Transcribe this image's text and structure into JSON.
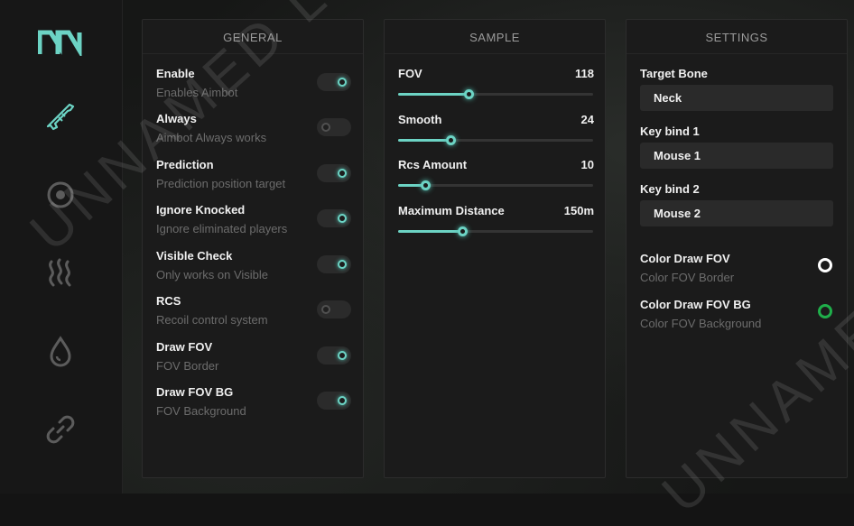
{
  "theme": {
    "accent": "#6cd3c4",
    "background": "#161716",
    "panel": "#1b1b1b",
    "muted_text": "#6c6c6c"
  },
  "sidebar": {
    "items": [
      {
        "icon": "rifle-icon",
        "active": true
      },
      {
        "icon": "eye-icon",
        "active": false
      },
      {
        "icon": "heat-waves-icon",
        "active": false
      },
      {
        "icon": "drop-icon",
        "active": false
      },
      {
        "icon": "link-icon",
        "active": false
      }
    ]
  },
  "general": {
    "title": "GENERAL",
    "options": [
      {
        "title": "Enable",
        "desc": "Enables Aimbot",
        "on": true
      },
      {
        "title": "Always",
        "desc": "Aimbot Always works",
        "on": false
      },
      {
        "title": "Prediction",
        "desc": "Prediction position target",
        "on": true
      },
      {
        "title": "Ignore Knocked",
        "desc": "Ignore eliminated players",
        "on": true
      },
      {
        "title": "Visible Check",
        "desc": "Only works on Visible",
        "on": true
      },
      {
        "title": "RCS",
        "desc": "Recoil control system",
        "on": false
      },
      {
        "title": "Draw FOV",
        "desc": "FOV Border",
        "on": true
      },
      {
        "title": "Draw FOV BG",
        "desc": "FOV Background",
        "on": true
      }
    ]
  },
  "sample": {
    "title": "SAMPLE",
    "sliders": [
      {
        "label": "FOV",
        "value": "118",
        "fraction": 0.36
      },
      {
        "label": "Smooth",
        "value": "24",
        "fraction": 0.27
      },
      {
        "label": "Rcs Amount",
        "value": "10",
        "fraction": 0.14
      },
      {
        "label": "Maximum Distance",
        "value": "150m",
        "fraction": 0.33
      }
    ]
  },
  "settings": {
    "title": "SETTINGS",
    "target_bone_label": "Target Bone",
    "target_bone_value": "Neck",
    "keybind1_label": "Key bind 1",
    "keybind1_value": "Mouse 1",
    "keybind2_label": "Key bind 2",
    "keybind2_value": "Mouse 2",
    "colors": [
      {
        "title": "Color Draw FOV",
        "desc": "Color FOV Border",
        "color": "#ffffff"
      },
      {
        "title": "Color Draw FOV BG",
        "desc": "Color FOV Background",
        "color": "#1fae4a"
      }
    ]
  },
  "watermark": {
    "text": "UNNAMED LITE",
    "text2": "UNNAMED"
  }
}
